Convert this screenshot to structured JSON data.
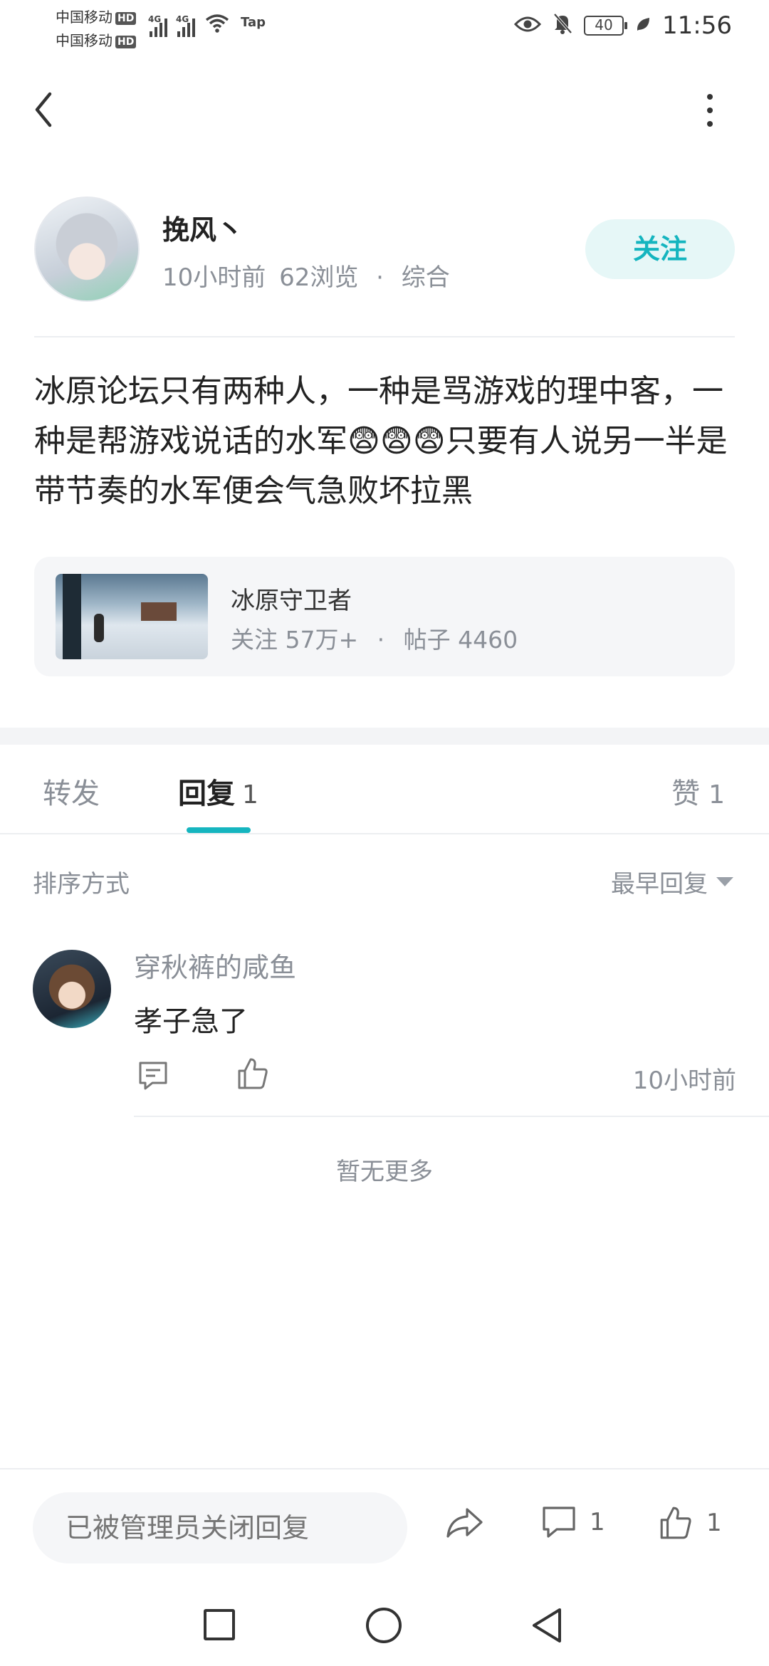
{
  "status_bar": {
    "carrier1": "中国移动",
    "carrier2": "中国移动",
    "hd_badge": "HD",
    "net1": "4G",
    "net2": "4G",
    "app_badge": "Tap",
    "battery": "40",
    "time": "11:56"
  },
  "post": {
    "author": "挽风丶",
    "time_ago": "10小时前",
    "views": "62浏览",
    "separator": "·",
    "category": "综合",
    "follow_label": "关注",
    "content": "冰原论坛只有两种人，一种是骂游戏的理中客，一种是帮游戏说话的水军😨😨😨只要有人说另一半是带节奏的水军便会气急败坏拉黑"
  },
  "game_card": {
    "name": "冰原守卫者",
    "followers": "关注 57万+",
    "separator": "·",
    "posts": "帖子 4460"
  },
  "tabs": {
    "forward": "转发",
    "reply": "回复",
    "reply_count": "1",
    "like": "赞",
    "like_count": "1"
  },
  "sort": {
    "label": "排序方式",
    "selected": "最早回复"
  },
  "comments": [
    {
      "name": "穿秋裤的咸鱼",
      "text": "孝子急了",
      "time": "10小时前"
    }
  ],
  "no_more": "暂无更多",
  "bottom_bar": {
    "input_placeholder": "已被管理员关闭回复",
    "comment_count": "1",
    "like_count": "1"
  },
  "colors": {
    "accent": "#15b5bf",
    "follow_bg": "#e6f7f7",
    "muted_text": "#8a8f97",
    "card_bg": "#f5f6f8"
  },
  "icons": {
    "back": "chevron-left-icon",
    "more": "more-vertical-icon",
    "share": "share-icon",
    "comment": "comment-icon",
    "like": "thumbs-up-icon",
    "reply": "reply-icon",
    "dropdown": "caret-down-icon"
  }
}
